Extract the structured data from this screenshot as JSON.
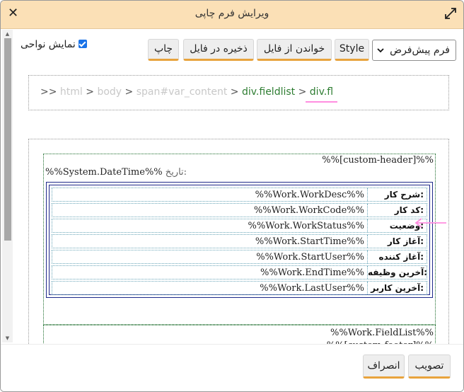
{
  "window": {
    "title": "ویرایش فرم چاپی",
    "close_glyph": "✕"
  },
  "toolbar": {
    "show_regions_label": "نمایش نواحی",
    "show_regions_checked": true,
    "template_selected": "فرم پیش‌فرض",
    "style_label": "Style",
    "load_file_label": "خواندن از فایل",
    "save_file_label": "ذخیره در فایل",
    "print_label": "چاپ",
    "accent_color": "#e8a33d"
  },
  "breadcrumb": {
    "prefix": ">>",
    "separator": ">",
    "items": [
      "html",
      "body",
      "span#var_content",
      "div.fieldlist",
      "div.fl"
    ]
  },
  "preview": {
    "custom_header": "%%[custom-header]%%",
    "date_label": "تاریخ:",
    "date_value": "%%System.DateTime%%",
    "fields": [
      {
        "label": "شرح کار:",
        "value": "%%Work.WorkDesc%%"
      },
      {
        "label": "کد کار:",
        "value": "%%Work.WorkCode%%"
      },
      {
        "label": "وضعیت:",
        "value": "%%Work.WorkStatus%%"
      },
      {
        "label": "آغاز کار:",
        "value": "%%Work.StartTime%%"
      },
      {
        "label": "آغاز کننده:",
        "value": "%%Work.StartUser%%"
      },
      {
        "label": "آخرین وظیفه:",
        "value": "%%Work.EndTime%%"
      },
      {
        "label": "آخرین کاربر:",
        "value": "%%Work.LastUser%%"
      }
    ],
    "field_list": "%%Work.FieldList%%",
    "custom_footer": "%%[custom-footer]%%"
  },
  "footer": {
    "approve_label": "تصویب",
    "cancel_label": "انصراف"
  }
}
